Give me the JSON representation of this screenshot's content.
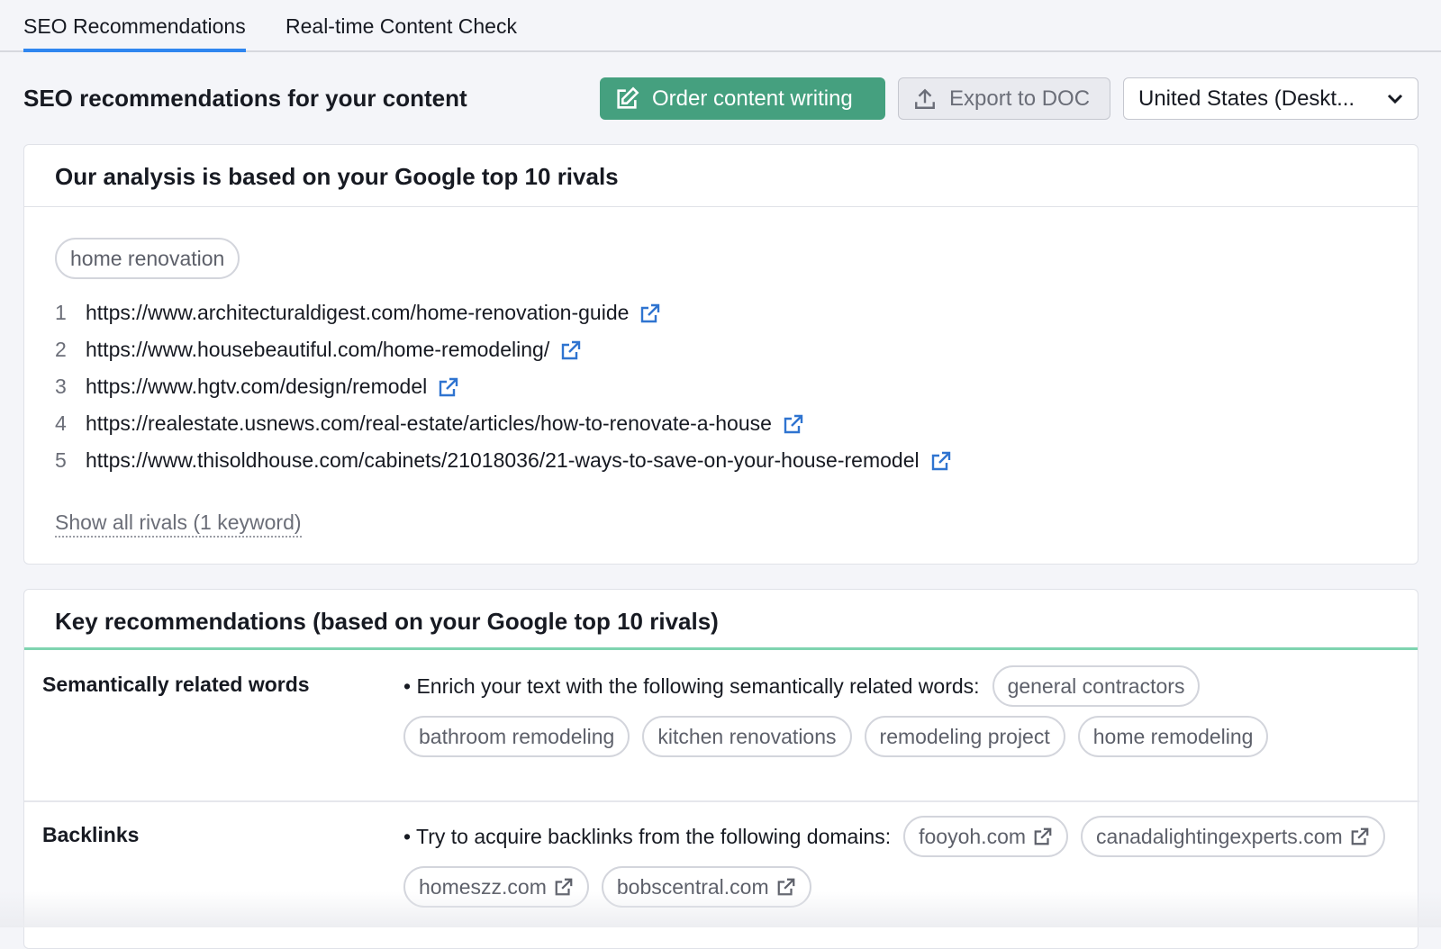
{
  "tabs": [
    {
      "label": "SEO Recommendations",
      "active": true
    },
    {
      "label": "Real-time Content Check",
      "active": false
    }
  ],
  "header": {
    "title": "SEO recommendations for your content",
    "order_label": "Order content writing",
    "export_label": "Export to DOC",
    "region_select": "United States (Deskt..."
  },
  "colors": {
    "accent": "#2f86f0",
    "green": "#45a07f",
    "link": "#2f74d0"
  },
  "analysis": {
    "title": "Our analysis is based on your Google top 10 rivals",
    "keyword": "home renovation",
    "rivals": [
      {
        "n": "1",
        "url": "https://www.architecturaldigest.com/home-renovation-guide"
      },
      {
        "n": "2",
        "url": "https://www.housebeautiful.com/home-remodeling/"
      },
      {
        "n": "3",
        "url": "https://www.hgtv.com/design/remodel"
      },
      {
        "n": "4",
        "url": "https://realestate.usnews.com/real-estate/articles/how-to-renovate-a-house"
      },
      {
        "n": "5",
        "url": "https://www.thisoldhouse.com/cabinets/21018036/21-ways-to-save-on-your-house-remodel"
      }
    ],
    "show_all": "Show all rivals (1 keyword)"
  },
  "key": {
    "title": "Key recommendations (based on your Google top 10 rivals)",
    "semantic": {
      "label": "Semantically related words",
      "text": "• Enrich your text with the following semantically related words:",
      "words": [
        "general contractors",
        "bathroom remodeling",
        "kitchen renovations",
        "remodeling project",
        "home remodeling"
      ]
    },
    "backlinks": {
      "label": "Backlinks",
      "text": "• Try to acquire backlinks from the following domains:",
      "domains": [
        "fooyoh.com",
        "canadalightingexperts.com",
        "homeszz.com",
        "bobscentral.com"
      ]
    }
  }
}
